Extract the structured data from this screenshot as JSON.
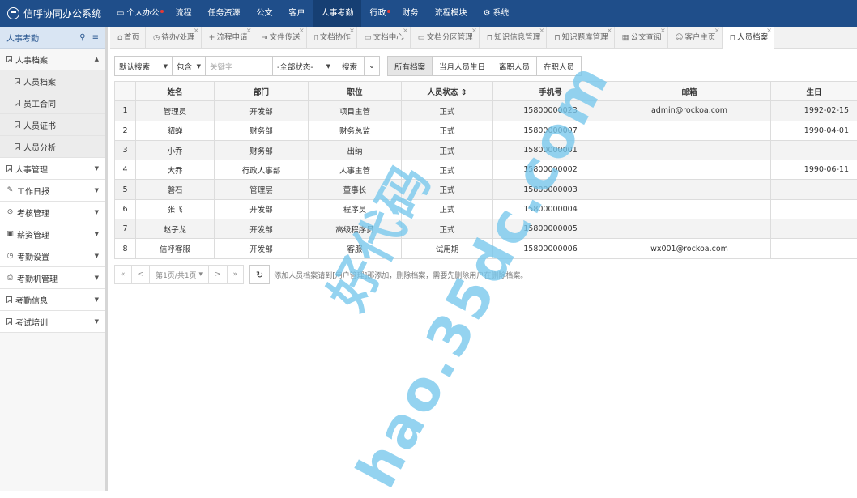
{
  "app": {
    "title": "信呼协同办公系统"
  },
  "topnav": [
    {
      "label": "个人办公",
      "icon": "monitor-icon",
      "dot": true,
      "active": false
    },
    {
      "label": "流程",
      "active": false
    },
    {
      "label": "任务资源",
      "active": false
    },
    {
      "label": "公文",
      "active": false
    },
    {
      "label": "客户",
      "active": false
    },
    {
      "label": "人事考勤",
      "active": true
    },
    {
      "label": "行政",
      "dot": true,
      "active": false
    },
    {
      "label": "财务",
      "active": false
    },
    {
      "label": "流程模块",
      "active": false
    },
    {
      "label": "系统",
      "icon": "gear-icon",
      "active": false
    }
  ],
  "sidebar": {
    "title": "人事考勤",
    "groups": [
      {
        "label": "人事档案",
        "icon": "bookmark-icon",
        "open": true,
        "items": [
          "人员档案",
          "员工合同",
          "人员证书",
          "人员分析"
        ]
      },
      {
        "label": "人事管理",
        "icon": "bookmark-icon"
      },
      {
        "label": "工作日报",
        "icon": "edit-icon"
      },
      {
        "label": "考核管理",
        "icon": "circle-check-icon"
      },
      {
        "label": "薪资管理",
        "icon": "money-icon"
      },
      {
        "label": "考勤设置",
        "icon": "clock-icon"
      },
      {
        "label": "考勤机管理",
        "icon": "print-icon"
      },
      {
        "label": "考勤信息",
        "icon": "bookmark-icon"
      },
      {
        "label": "考试培训",
        "icon": "bookmark-icon"
      }
    ]
  },
  "tabs": [
    {
      "label": "首页",
      "icon": "home-icon"
    },
    {
      "label": "待办/处理",
      "icon": "clock-icon"
    },
    {
      "label": "流程申请",
      "icon": "plus-icon"
    },
    {
      "label": "文件传送",
      "icon": "share-icon"
    },
    {
      "label": "文档协作",
      "icon": "file-icon"
    },
    {
      "label": "文档中心",
      "icon": "folder-icon"
    },
    {
      "label": "文档分区管理",
      "icon": "folder-icon"
    },
    {
      "label": "知识信息管理",
      "icon": "bookmark-icon"
    },
    {
      "label": "知识题库管理",
      "icon": "bookmark-icon"
    },
    {
      "label": "公文查阅",
      "icon": "briefcase-icon"
    },
    {
      "label": "客户主页",
      "icon": "user-icon"
    },
    {
      "label": "人员档案",
      "icon": "bookmark-icon",
      "active": true
    }
  ],
  "toolbar": {
    "search_type": "默认搜索",
    "match_mode": "包含",
    "keyword_placeholder": "关键字",
    "status_filter": "-全部状态-",
    "search_button": "搜索",
    "filters": [
      "所有档案",
      "当月人员生日",
      "离职人员",
      "在职人员"
    ],
    "active_filter": "所有档案"
  },
  "table": {
    "columns": [
      "",
      "姓名",
      "部门",
      "职位",
      "人员状态",
      "手机号",
      "邮箱",
      "生日"
    ],
    "rows": [
      [
        "1",
        "管理员",
        "开发部",
        "项目主管",
        "正式",
        "15800000023",
        "admin@rockoa.com",
        "1992-02-15"
      ],
      [
        "2",
        "貂蝉",
        "财务部",
        "财务总监",
        "正式",
        "15800000007",
        "",
        "1990-04-01"
      ],
      [
        "3",
        "小乔",
        "财务部",
        "出纳",
        "正式",
        "15800000001",
        "",
        ""
      ],
      [
        "4",
        "大乔",
        "行政人事部",
        "人事主管",
        "正式",
        "15800000002",
        "",
        "1990-06-11"
      ],
      [
        "5",
        "磐石",
        "管理层",
        "董事长",
        "正式",
        "15800000003",
        "",
        ""
      ],
      [
        "6",
        "张飞",
        "开发部",
        "程序员",
        "正式",
        "15800000004",
        "",
        ""
      ],
      [
        "7",
        "赵子龙",
        "开发部",
        "高级程序员",
        "正式",
        "15800000005",
        "",
        ""
      ],
      [
        "8",
        "信呼客服",
        "开发部",
        "客服",
        "试用期",
        "15800000006",
        "wx001@rockoa.com",
        ""
      ]
    ]
  },
  "pager": {
    "first": "«",
    "prev": "<",
    "page_info": "第1页/共1页",
    "next": ">",
    "last": "»",
    "note": "添加人员档案请到[用户管理]那添加，删除档案，需要先删除用户在删除档案。"
  },
  "watermark": {
    "text_cn": "好代码",
    "text_url": "hao.35dc.com"
  }
}
